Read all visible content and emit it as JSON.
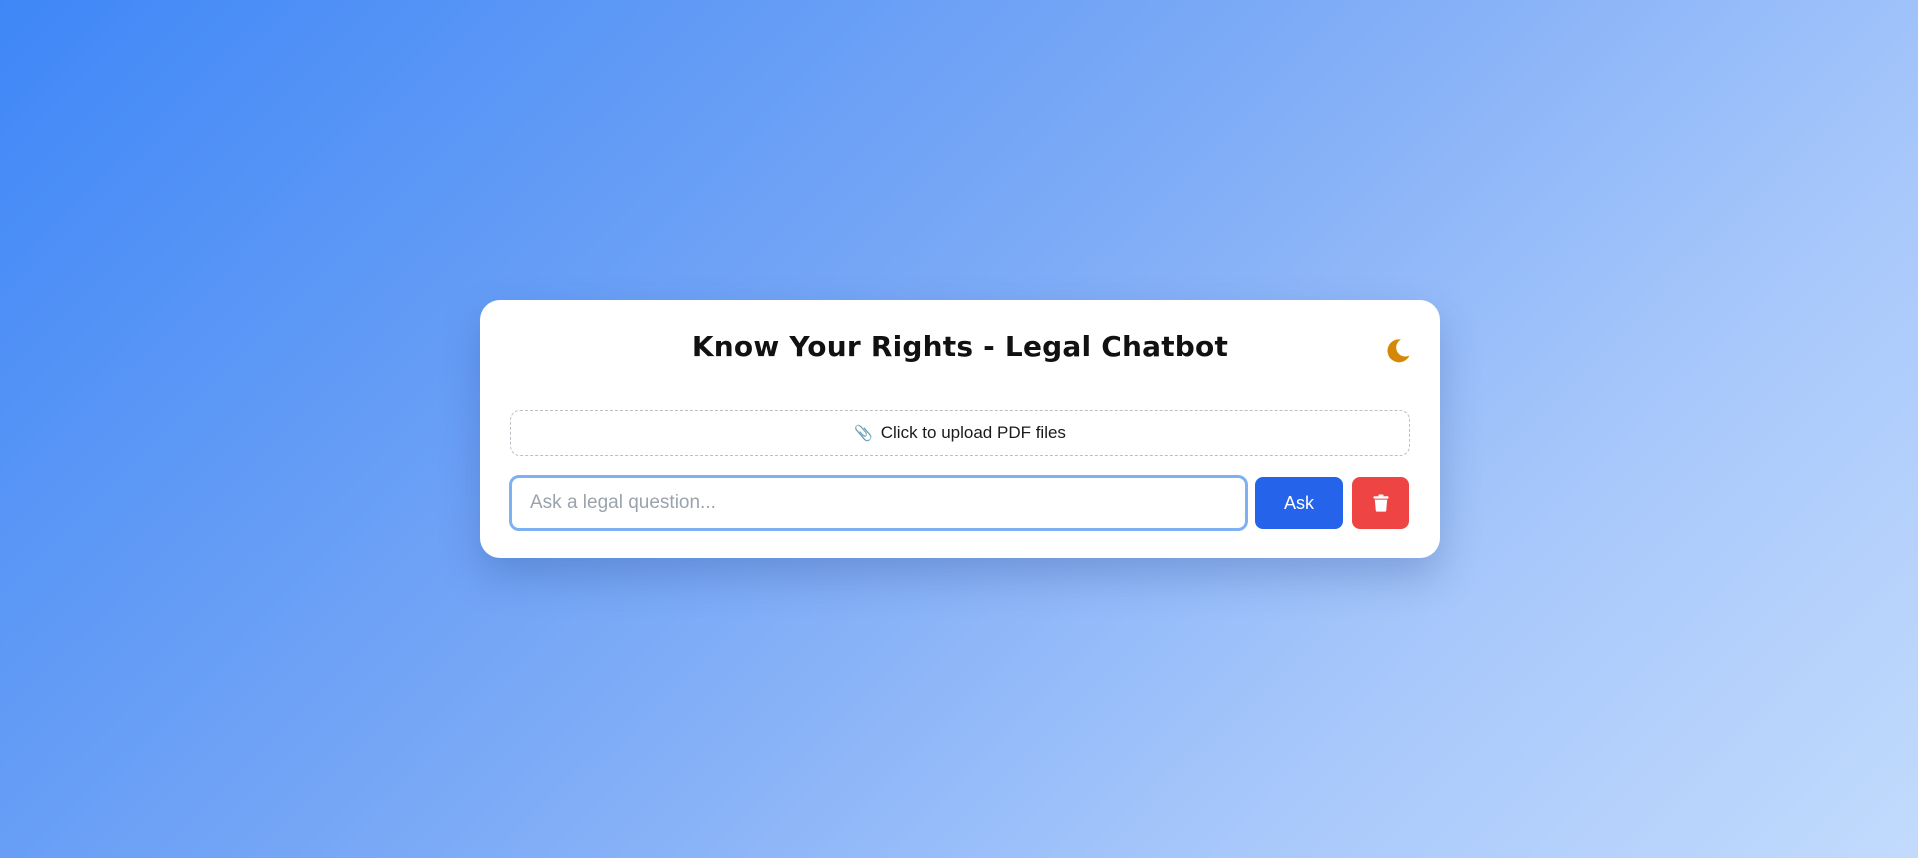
{
  "header": {
    "title": "Know Your Rights - Legal Chatbot",
    "theme_toggle_icon": "moon-icon",
    "moon_color": "#d48806"
  },
  "upload": {
    "icon": "paperclip-icon",
    "label": "Click to upload PDF files"
  },
  "chat_input": {
    "value": "",
    "placeholder": "Ask a legal question..."
  },
  "actions": {
    "ask_label": "Ask",
    "ask_color": "#2563eb",
    "clear_icon": "trash-icon",
    "clear_color": "#ef4444"
  }
}
